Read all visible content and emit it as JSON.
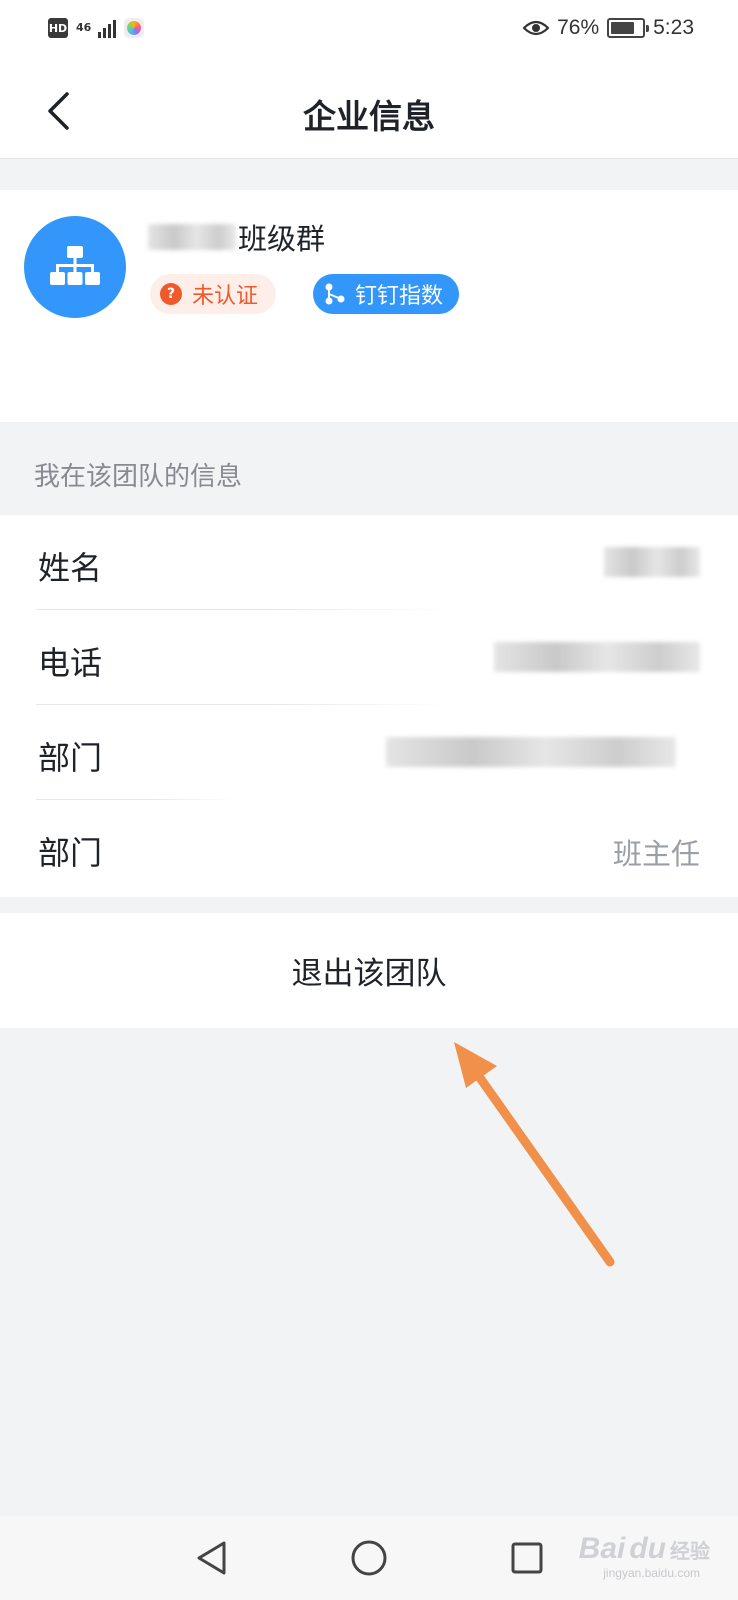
{
  "status_bar": {
    "hd_label": "HD",
    "network_label": "46",
    "battery_percent": "76%",
    "battery_level": 0.76,
    "time": "5:23",
    "icons": [
      "hd-icon",
      "signal-icon",
      "app-icon",
      "eye-icon",
      "battery-icon"
    ]
  },
  "header": {
    "back_icon": "chevron-left-icon",
    "title": "企业信息"
  },
  "org": {
    "avatar_icon": "org-chart-icon",
    "avatar_color": "#3296fa",
    "name_suffix": "班级群",
    "tags": [
      {
        "label": "未认证",
        "icon": "question-circle-icon",
        "color": "#f05a2a"
      },
      {
        "label": "钉钉指数",
        "icon": "share-nodes-icon",
        "color": "#3296fa"
      }
    ]
  },
  "member_section": {
    "header": "我在该团队的信息",
    "rows": [
      {
        "label": "姓名",
        "value": ""
      },
      {
        "label": "电话",
        "value": ""
      },
      {
        "label": "部门",
        "value": ""
      },
      {
        "label": "部门",
        "value": "班主任"
      }
    ]
  },
  "actions": {
    "leave_label": "退出该团队"
  },
  "system_nav": {
    "icons": [
      "nav-back-triangle-icon",
      "nav-home-circle-icon",
      "nav-recents-square-icon"
    ]
  },
  "watermark": {
    "brand": "Bai",
    "paw": "du",
    "cn": "经验",
    "url": "jingyan.baidu.com"
  },
  "colors": {
    "accent_blue": "#3296fa",
    "warning_orange": "#f05a2a",
    "annotation_arrow": "#f0904a",
    "background": "#f2f3f5"
  }
}
